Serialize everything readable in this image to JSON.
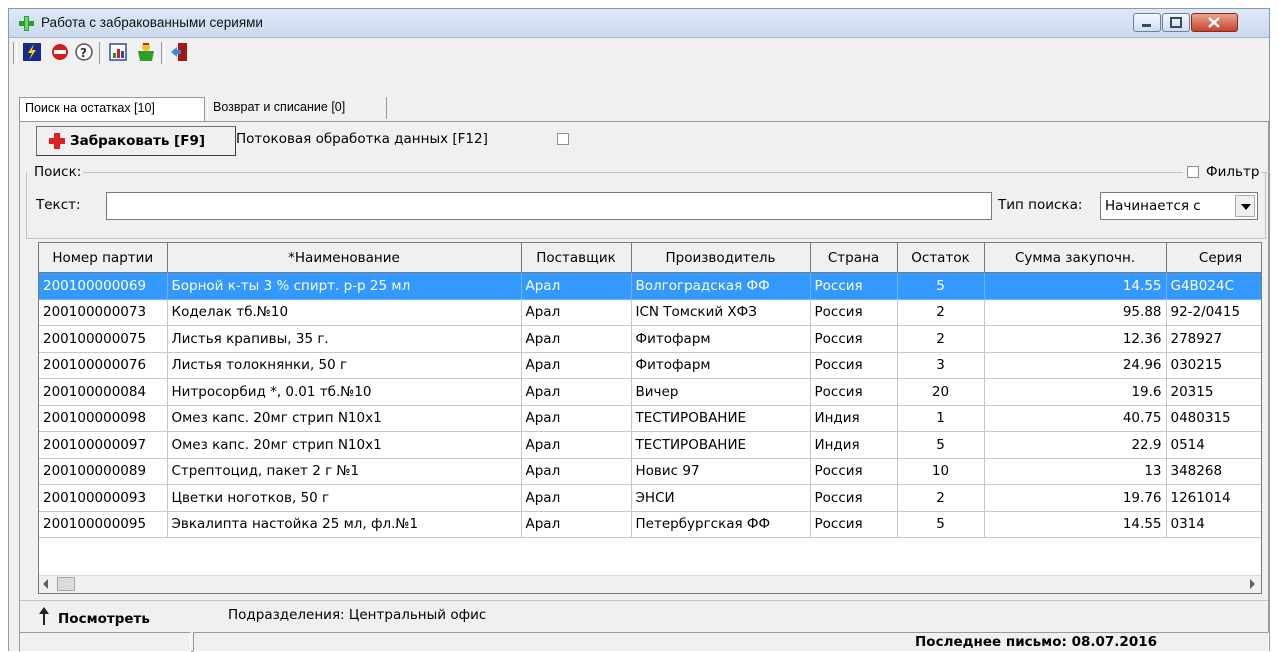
{
  "window": {
    "title": "Работа с забракованными сериями"
  },
  "tabs": [
    {
      "label": "Поиск на остатках [10]"
    },
    {
      "label": "Возврат и списание [0]"
    }
  ],
  "actions": {
    "reject_label": "Забраковать [F9]",
    "stream_label": "Потоковая обработка данных [F12]"
  },
  "search": {
    "caption": "Поиск:",
    "filter_label": "Фильтр",
    "text_label": "Текст:",
    "text_value": "",
    "type_label": "Тип поиска:",
    "type_value": "Начинается с"
  },
  "table": {
    "columns": [
      "Номер партии",
      "*Наименование",
      "Поставщик",
      "Производитель",
      "Страна",
      "Остаток",
      "Сумма закупочн.",
      "Серия"
    ],
    "rows": [
      [
        "200100000069",
        "Борной к-ты 3 % спирт. р-р 25 мл",
        "Арал",
        "Волгоградская ФФ",
        "Россия",
        "5",
        "14.55",
        "G4B024C"
      ],
      [
        "200100000073",
        "Коделак тб.№10",
        "Арал",
        "ICN Томский ХФЗ",
        "Россия",
        "2",
        "95.88",
        "92-2/0415"
      ],
      [
        "200100000075",
        "Листья крапивы,  35 г.",
        "Арал",
        "Фитофарм",
        "Россия",
        "2",
        "12.36",
        "278927"
      ],
      [
        "200100000076",
        "Листья толокнянки, 50 г",
        "Арал",
        "Фитофарм",
        "Россия",
        "3",
        "24.96",
        "030215"
      ],
      [
        "200100000084",
        "Нитросорбид *, 0.01 тб.№10",
        "Арал",
        "Вичер",
        "Россия",
        "20",
        "19.6",
        "20315"
      ],
      [
        "200100000098",
        "Омез капс. 20мг стрип N10x1",
        "Арал",
        "ТЕСТИРОВАНИЕ",
        "Индия",
        "1",
        "40.75",
        "0480315"
      ],
      [
        "200100000097",
        "Омез капс. 20мг стрип N10x1",
        "Арал",
        "ТЕСТИРОВАНИЕ",
        "Индия",
        "5",
        "22.9",
        "0514"
      ],
      [
        "200100000089",
        "Стрептоцид, пакет 2 г №1",
        "Арал",
        "Новис 97",
        "Россия",
        "10",
        "13",
        "348268"
      ],
      [
        "200100000093",
        "Цветки ноготков, 50 г",
        "Арал",
        "ЭНСИ",
        "Россия",
        "2",
        "19.76",
        "1261014"
      ],
      [
        "200100000095",
        "Эвкалипта настойка 25 мл, фл.№1",
        "Арал",
        "Петербургская ФФ",
        "Россия",
        "5",
        "14.55",
        "0314"
      ]
    ]
  },
  "bottom": {
    "view_label": "Посмотреть",
    "dept_label": "Подразделения: Центральный офис"
  },
  "status": {
    "last_letter": "Последнее письмо: 08.07.2016"
  },
  "colors": {
    "selection": "#3399ff",
    "accent_red": "#e02020"
  }
}
